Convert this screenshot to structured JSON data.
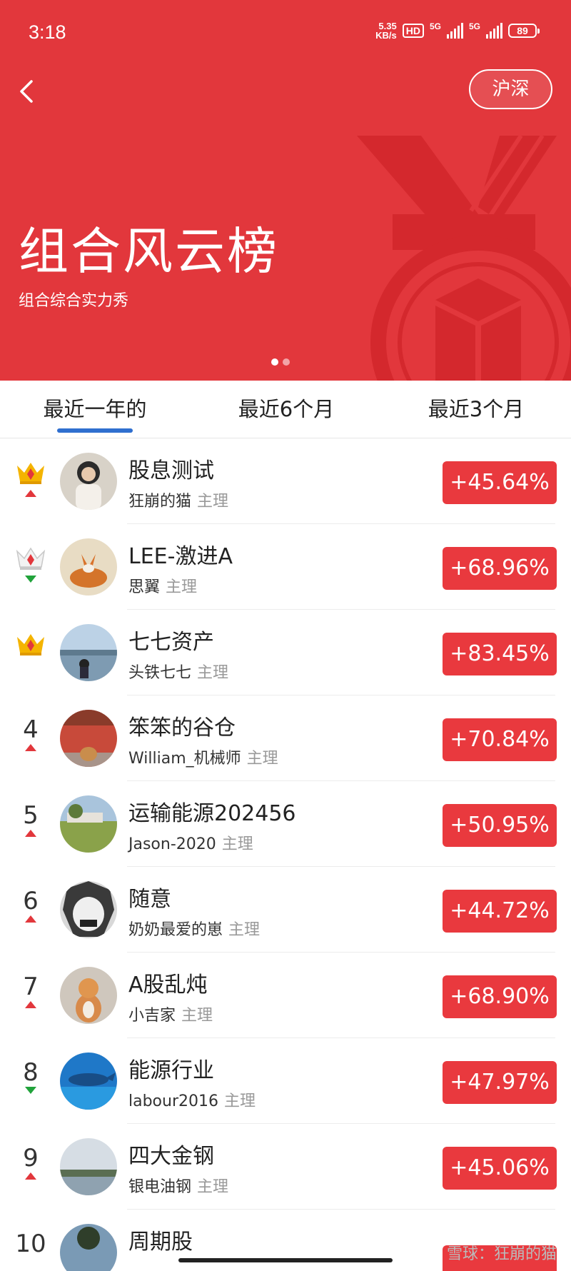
{
  "status": {
    "time": "3:18",
    "speed_value": "5.35",
    "speed_unit": "KB/s",
    "hd": "HD",
    "net1": "5G",
    "net2": "5G",
    "battery": "89"
  },
  "header": {
    "back_icon": "chevron-left-icon",
    "market_button": "沪深",
    "title": "组合风云榜",
    "subtitle": "组合综合实力秀",
    "page_dots": 2,
    "active_dot": 0
  },
  "tabs": [
    {
      "label": "最近一年的",
      "active": true
    },
    {
      "label": "最近6个月",
      "active": false
    },
    {
      "label": "最近3个月",
      "active": false
    }
  ],
  "role_label": "主理",
  "colors": {
    "brand_red": "#e2373c",
    "return_red": "#e9393e",
    "tab_underline": "#2f6fcf",
    "up": "#e2373c",
    "down": "#21a33b",
    "crown_gold": "#f4b400",
    "crown_silver": "#c8c8c8"
  },
  "rows": [
    {
      "rank": "",
      "badge": "gold-crown",
      "trend": "up",
      "name": "股息测试",
      "owner": "狂崩的猫",
      "return": "+45.64%"
    },
    {
      "rank": "",
      "badge": "silver-crown",
      "trend": "down",
      "name": "LEE-激进A",
      "owner": "思翼",
      "return": "+68.96%"
    },
    {
      "rank": "",
      "badge": "gold-crown",
      "trend": "none",
      "name": "七七资产",
      "owner": "头铁七七",
      "return": "+83.45%"
    },
    {
      "rank": "4",
      "badge": "",
      "trend": "up",
      "name": "笨笨的谷仓",
      "owner": "William_机械师",
      "return": "+70.84%"
    },
    {
      "rank": "5",
      "badge": "",
      "trend": "up",
      "name": "运输能源202456",
      "owner": "Jason-2020",
      "return": "+50.95%"
    },
    {
      "rank": "6",
      "badge": "",
      "trend": "up",
      "name": "随意",
      "owner": "奶奶最爱的崽",
      "return": "+44.72%"
    },
    {
      "rank": "7",
      "badge": "",
      "trend": "up",
      "name": "A股乱炖",
      "owner": "小吉家",
      "return": "+68.90%"
    },
    {
      "rank": "8",
      "badge": "",
      "trend": "down",
      "name": "能源行业",
      "owner": "labour2016",
      "return": "+47.97%"
    },
    {
      "rank": "9",
      "badge": "",
      "trend": "up",
      "name": "四大金钢",
      "owner": "银电油钢",
      "return": "+45.06%"
    },
    {
      "rank": "10",
      "badge": "",
      "trend": "",
      "name": "周期股",
      "owner": "",
      "return": ""
    }
  ],
  "watermark": "雪球：狂崩的猫"
}
